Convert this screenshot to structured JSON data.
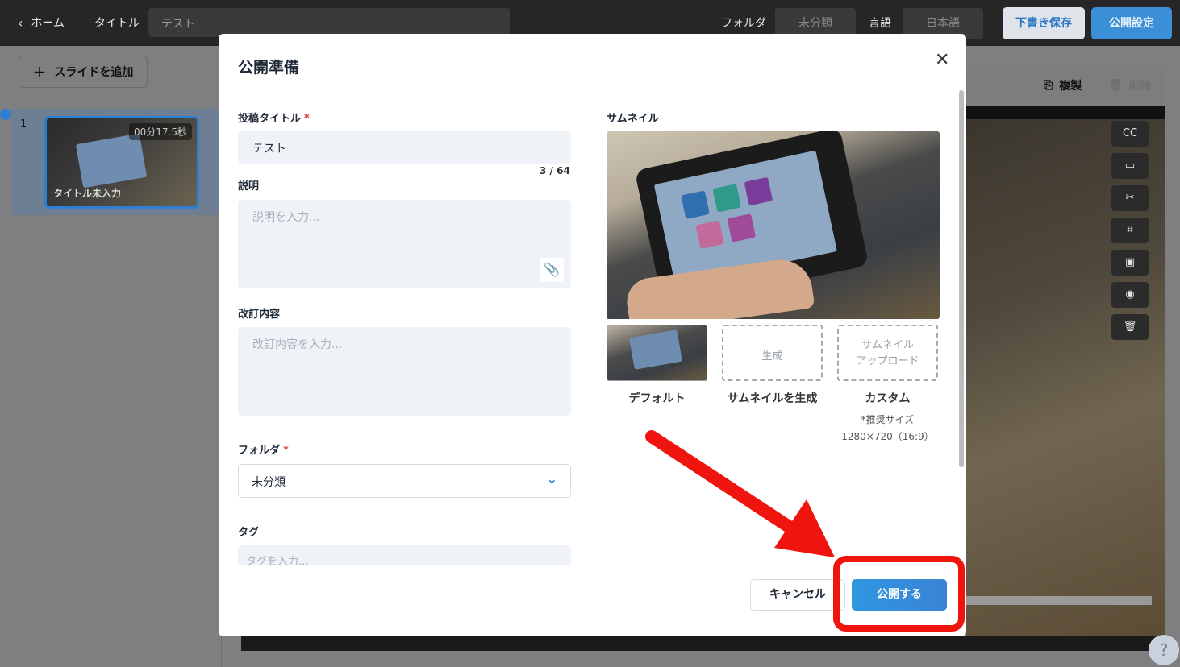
{
  "topbar": {
    "back_label": "ホーム",
    "title_label": "タイトル",
    "title_value": "テスト",
    "folder_label": "フォルダ",
    "folder_value": "未分類",
    "language_label": "言語",
    "language_value": "日本語",
    "draft_button": "下書き保存",
    "publish_settings_button": "公開設定"
  },
  "sidebar": {
    "add_slide_label": "スライドを追加",
    "slides": [
      {
        "number": "1",
        "duration": "00分17.5秒",
        "title": "タイトル未入力"
      }
    ]
  },
  "editor": {
    "copy_label": "複製",
    "delete_label": "削除",
    "help_label": "?"
  },
  "modal": {
    "title": "公開準備",
    "post_title_label": "投稿タイトル",
    "post_title_value": "テスト",
    "post_title_counter": "3 / 64",
    "description_label": "説明",
    "description_placeholder": "説明を入力...",
    "revision_label": "改訂内容",
    "revision_placeholder": "改訂内容を入力...",
    "folder_label": "フォルダ",
    "folder_value": "未分類",
    "tag_label": "タグ",
    "tag_placeholder": "タグを入力...",
    "thumbnail_label": "サムネイル",
    "thumbnail_options": [
      {
        "box_text": "",
        "label": "デフォルト"
      },
      {
        "box_text": "生成",
        "label": "サムネイルを生成"
      },
      {
        "box_text": "サムネイル\nアップロード",
        "label": "カスタム"
      }
    ],
    "recommended_size_note": "*推奨サイズ",
    "recommended_size_value": "1280×720（16:9）",
    "cancel_button": "キャンセル",
    "publish_button": "公開する",
    "required_mark": "*"
  },
  "colors": {
    "accent": "#3b8fd9",
    "annotation": "#f0140f",
    "required": "#e0322d"
  }
}
